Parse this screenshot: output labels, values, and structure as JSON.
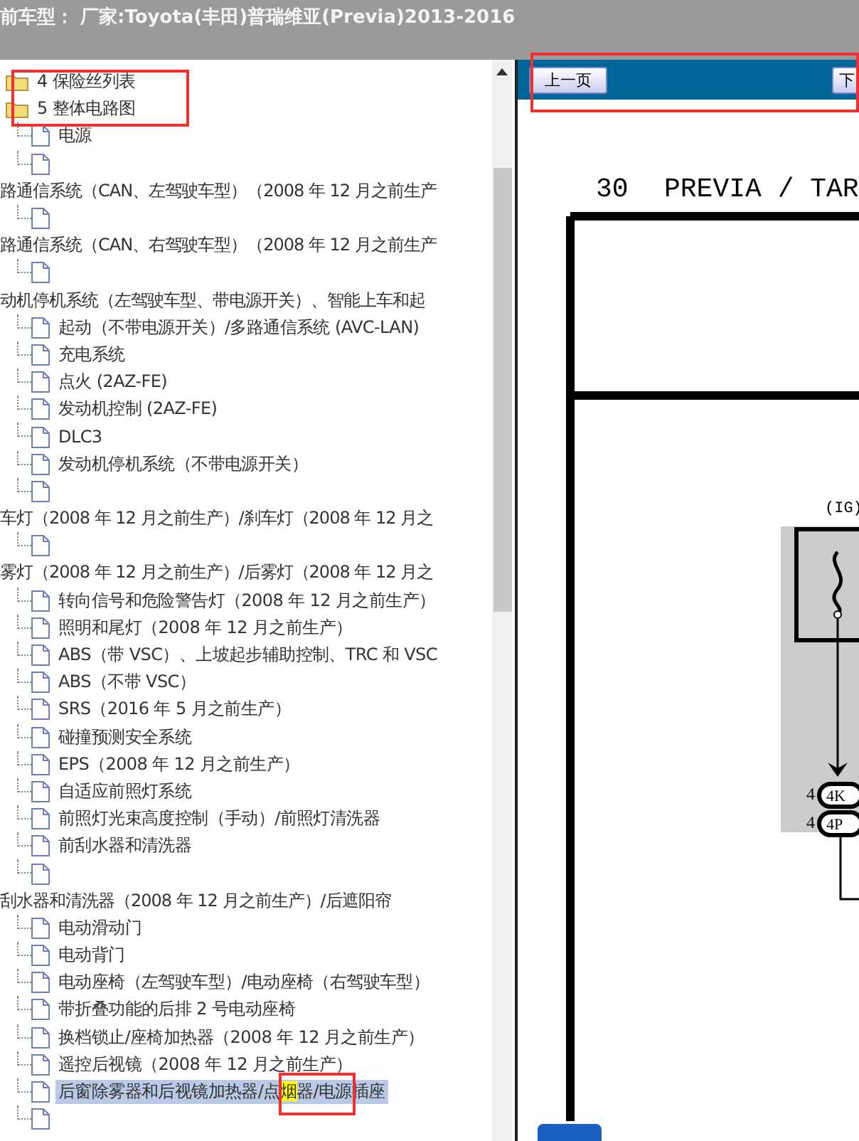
{
  "header": {
    "title": "前车型： 厂家:Toyota(丰田)普瑞维亚(Previa)2013-2016"
  },
  "tree": {
    "items": [
      {
        "kind": "folder",
        "label": "4 保险丝列表",
        "selected": false
      },
      {
        "kind": "folder",
        "label": "5 整体电路图",
        "selected": false
      },
      {
        "kind": "doc",
        "label": "电源",
        "selected": false
      },
      {
        "kind": "doc"
      },
      {
        "kind": "line",
        "label": "路通信系统（CAN、左驾驶车型）（2008 年 12 月之前生产"
      },
      {
        "kind": "doc"
      },
      {
        "kind": "line",
        "label": "路通信系统（CAN、右驾驶车型）（2008 年 12 月之前生产"
      },
      {
        "kind": "doc"
      },
      {
        "kind": "line",
        "label": "动机停机系统（左驾驶车型、带电源开关）、智能上车和起"
      },
      {
        "kind": "doc",
        "label": "起动（不带电源开关）/多路通信系统 (AVC-LAN)",
        "selected": false
      },
      {
        "kind": "doc",
        "label": "充电系统",
        "selected": false
      },
      {
        "kind": "doc",
        "label": "点火 (2AZ-FE)",
        "selected": false
      },
      {
        "kind": "doc",
        "label": "发动机控制 (2AZ-FE)",
        "selected": false
      },
      {
        "kind": "doc",
        "label": "DLC3",
        "selected": false
      },
      {
        "kind": "doc",
        "label": "发动机停机系统（不带电源开关）",
        "selected": false
      },
      {
        "kind": "doc"
      },
      {
        "kind": "line",
        "label": "车灯（2008 年 12 月之前生产）/刹车灯（2008 年 12 月之"
      },
      {
        "kind": "doc"
      },
      {
        "kind": "line",
        "label": "雾灯（2008 年 12 月之前生产）/后雾灯（2008 年 12 月之"
      },
      {
        "kind": "doc",
        "label": "转向信号和危险警告灯（2008 年 12 月之前生产）",
        "selected": false
      },
      {
        "kind": "doc",
        "label": "照明和尾灯（2008 年 12 月之前生产）",
        "selected": false
      },
      {
        "kind": "doc",
        "label": "ABS（带 VSC）、上坡起步辅助控制、TRC 和 VSC",
        "selected": false
      },
      {
        "kind": "doc",
        "label": "ABS（不带 VSC）",
        "selected": false
      },
      {
        "kind": "doc",
        "label": "SRS（2016 年 5 月之前生产）",
        "selected": false
      },
      {
        "kind": "doc",
        "label": "碰撞预测安全系统",
        "selected": false
      },
      {
        "kind": "doc",
        "label": "EPS（2008 年 12 月之前生产）",
        "selected": false
      },
      {
        "kind": "doc",
        "label": "自适应前照灯系统",
        "selected": false
      },
      {
        "kind": "doc",
        "label": "前照灯光束高度控制（手动）/前照灯清洗器",
        "selected": false
      },
      {
        "kind": "doc",
        "label": "前刮水器和清洗器",
        "selected": false
      },
      {
        "kind": "doc"
      },
      {
        "kind": "line",
        "label": "刮水器和清洗器（2008 年 12 月之前生产）/后遮阳帘"
      },
      {
        "kind": "doc",
        "label": "电动滑动门",
        "selected": false
      },
      {
        "kind": "doc",
        "label": "电动背门",
        "selected": false
      },
      {
        "kind": "doc",
        "label": "电动座椅（左驾驶车型）/电动座椅（右驾驶车型）",
        "selected": false
      },
      {
        "kind": "doc",
        "label": "带折叠功能的后排 2 号电动座椅",
        "selected": false
      },
      {
        "kind": "doc",
        "label": "换档锁止/座椅加热器（2008 年 12 月之前生产）",
        "selected": false
      },
      {
        "kind": "doc",
        "label": "遥控后视镜（2008 年 12 月之前生产）",
        "selected": false
      },
      {
        "kind": "doc",
        "label": "后窗除雾器和后视镜加热器/点",
        "match": "烟",
        "label_after": "器/电源插座",
        "selected": true
      },
      {
        "kind": "doc"
      }
    ]
  },
  "viewer": {
    "toolbar": {
      "prev": "上一页",
      "next": "下"
    },
    "diagram": {
      "page": "30",
      "title": "PREVIA / TAR",
      "relay": "(IG)",
      "pins": [
        {
          "num": "4",
          "code": "4K"
        },
        {
          "num": "4",
          "code": "4P"
        }
      ]
    }
  }
}
